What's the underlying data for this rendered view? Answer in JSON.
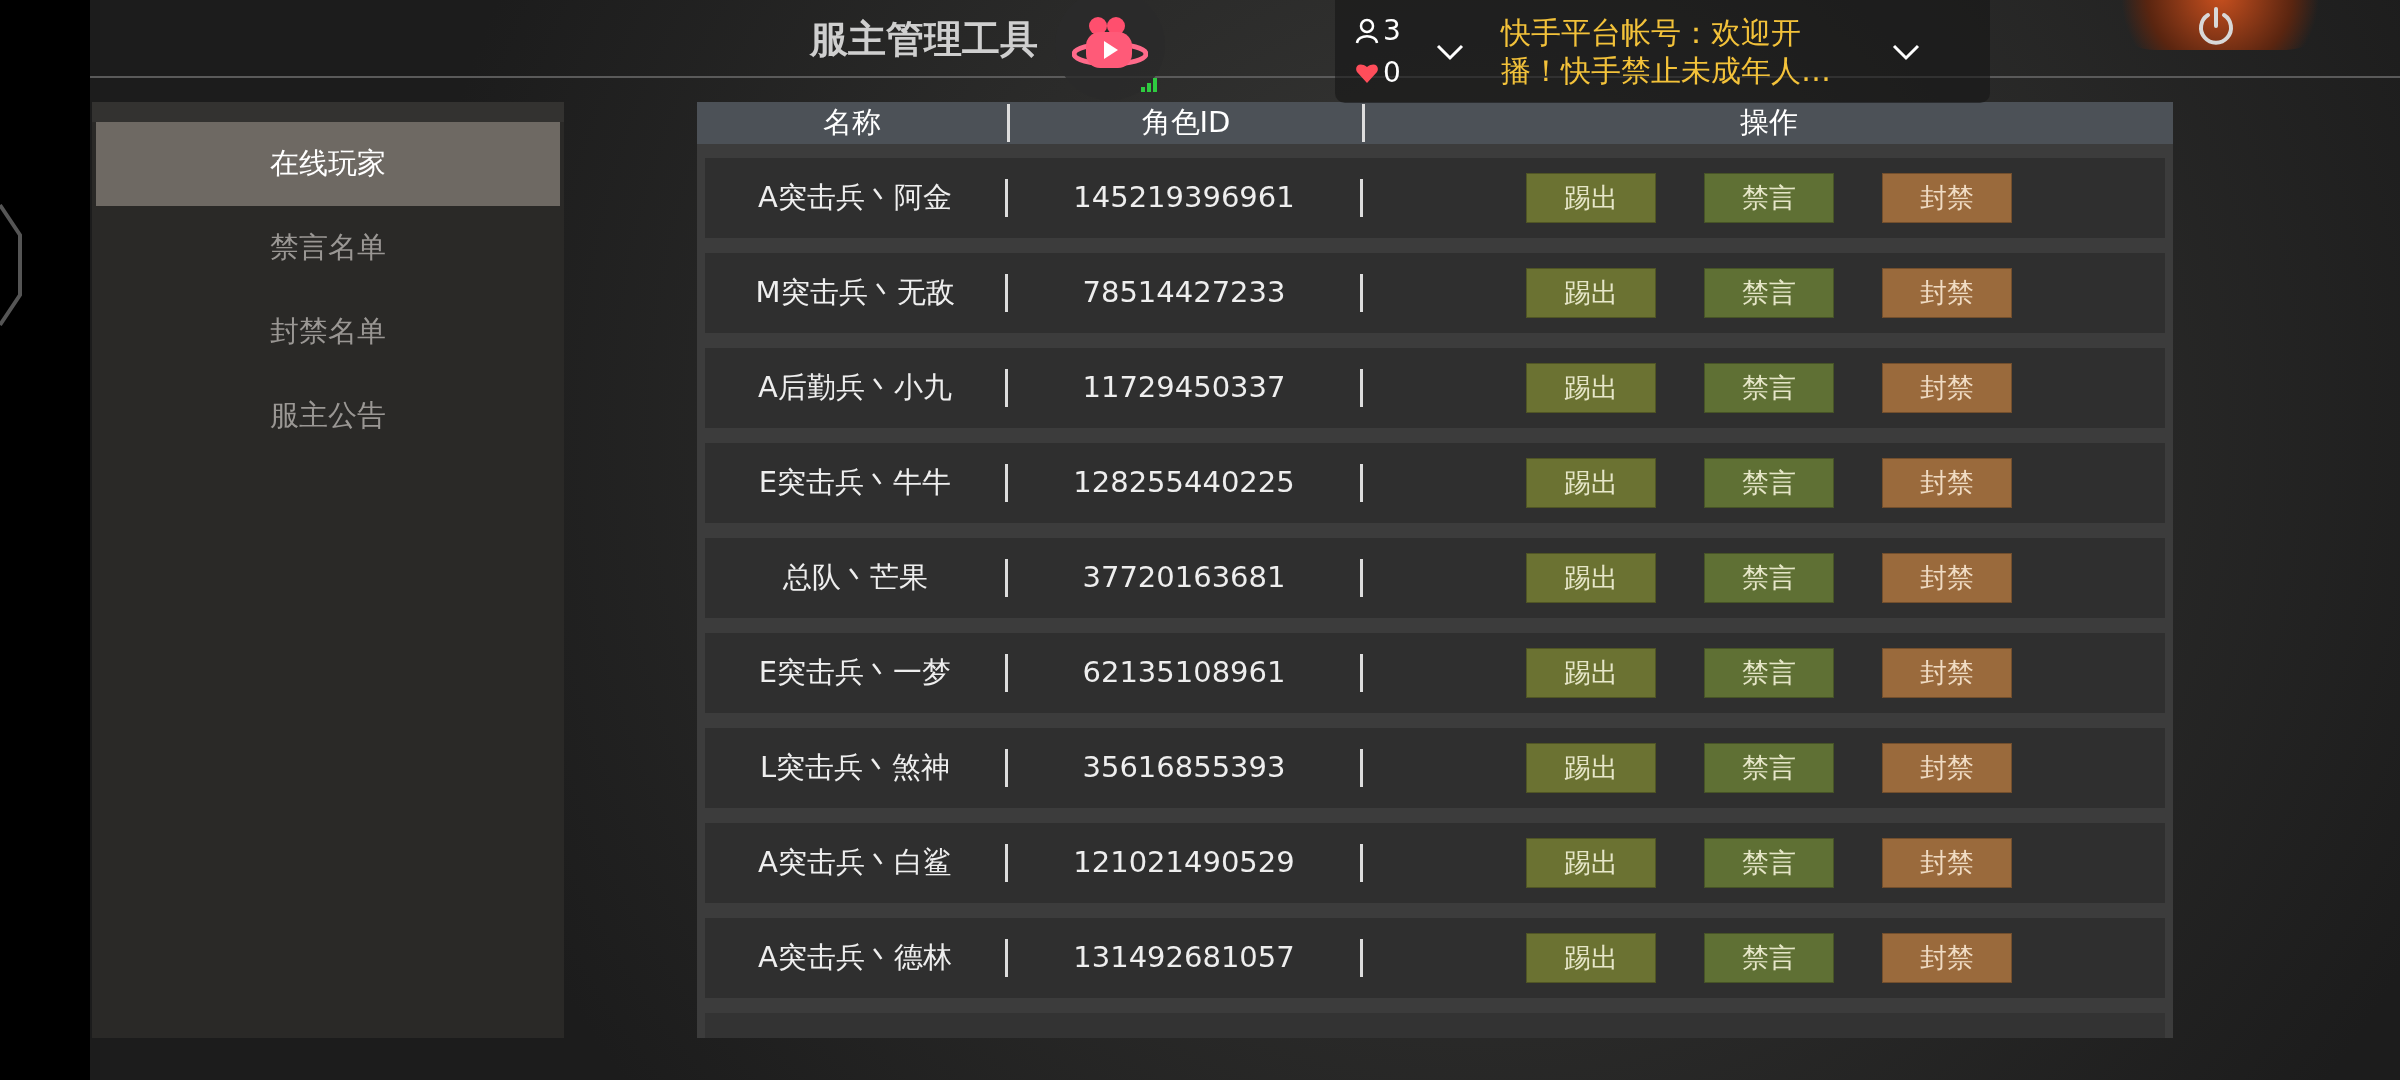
{
  "title": "服主管理工具",
  "live_overlay": {
    "viewers": "3",
    "likes": "0",
    "notice": "快手平台帐号：欢迎开播！快手禁止未成年人…"
  },
  "sidebar": {
    "items": [
      {
        "label": "在线玩家",
        "selected": true
      },
      {
        "label": "禁言名单",
        "selected": false
      },
      {
        "label": "封禁名单",
        "selected": false
      },
      {
        "label": "服主公告",
        "selected": false
      }
    ]
  },
  "table": {
    "columns": [
      "名称",
      "角色ID",
      "操作"
    ],
    "rows": [
      {
        "name": "A突击兵丶阿金",
        "id": "145219396961",
        "actions": [
          {
            "label": "踢出",
            "kind": "kick"
          },
          {
            "label": "禁言",
            "kind": "mute"
          },
          {
            "label": "封禁",
            "kind": "ban"
          }
        ]
      },
      {
        "name": "M突击兵丶无敌",
        "id": "78514427233",
        "actions": [
          {
            "label": "踢出",
            "kind": "kick"
          },
          {
            "label": "禁言",
            "kind": "mute"
          },
          {
            "label": "封禁",
            "kind": "ban"
          }
        ]
      },
      {
        "name": "A后勤兵丶小九",
        "id": "11729450337",
        "actions": [
          {
            "label": "踢出",
            "kind": "kick"
          },
          {
            "label": "禁言",
            "kind": "mute"
          },
          {
            "label": "封禁",
            "kind": "ban"
          }
        ]
      },
      {
        "name": "E突击兵丶牛牛",
        "id": "128255440225",
        "actions": [
          {
            "label": "踢出",
            "kind": "kick"
          },
          {
            "label": "禁言",
            "kind": "mute"
          },
          {
            "label": "封禁",
            "kind": "ban"
          }
        ]
      },
      {
        "name": "总队丶芒果",
        "id": "37720163681",
        "actions": [
          {
            "label": "踢出",
            "kind": "kick"
          },
          {
            "label": "禁言",
            "kind": "mute"
          },
          {
            "label": "封禁",
            "kind": "ban"
          }
        ]
      },
      {
        "name": "E突击兵丶一梦",
        "id": "62135108961",
        "actions": [
          {
            "label": "踢出",
            "kind": "kick"
          },
          {
            "label": "禁言",
            "kind": "mute"
          },
          {
            "label": "封禁",
            "kind": "ban"
          }
        ]
      },
      {
        "name": "L突击兵丶煞神",
        "id": "35616855393",
        "actions": [
          {
            "label": "踢出",
            "kind": "kick"
          },
          {
            "label": "禁言",
            "kind": "mute"
          },
          {
            "label": "封禁",
            "kind": "ban"
          }
        ]
      },
      {
        "name": "A突击兵丶白鲨",
        "id": "121021490529",
        "actions": [
          {
            "label": "踢出",
            "kind": "kick"
          },
          {
            "label": "禁言",
            "kind": "mute"
          },
          {
            "label": "封禁",
            "kind": "ban"
          }
        ]
      },
      {
        "name": "A突击兵丶德林",
        "id": "131492681057",
        "actions": [
          {
            "label": "踢出",
            "kind": "kick"
          },
          {
            "label": "禁言",
            "kind": "mute"
          },
          {
            "label": "封禁",
            "kind": "ban"
          }
        ]
      }
    ]
  }
}
